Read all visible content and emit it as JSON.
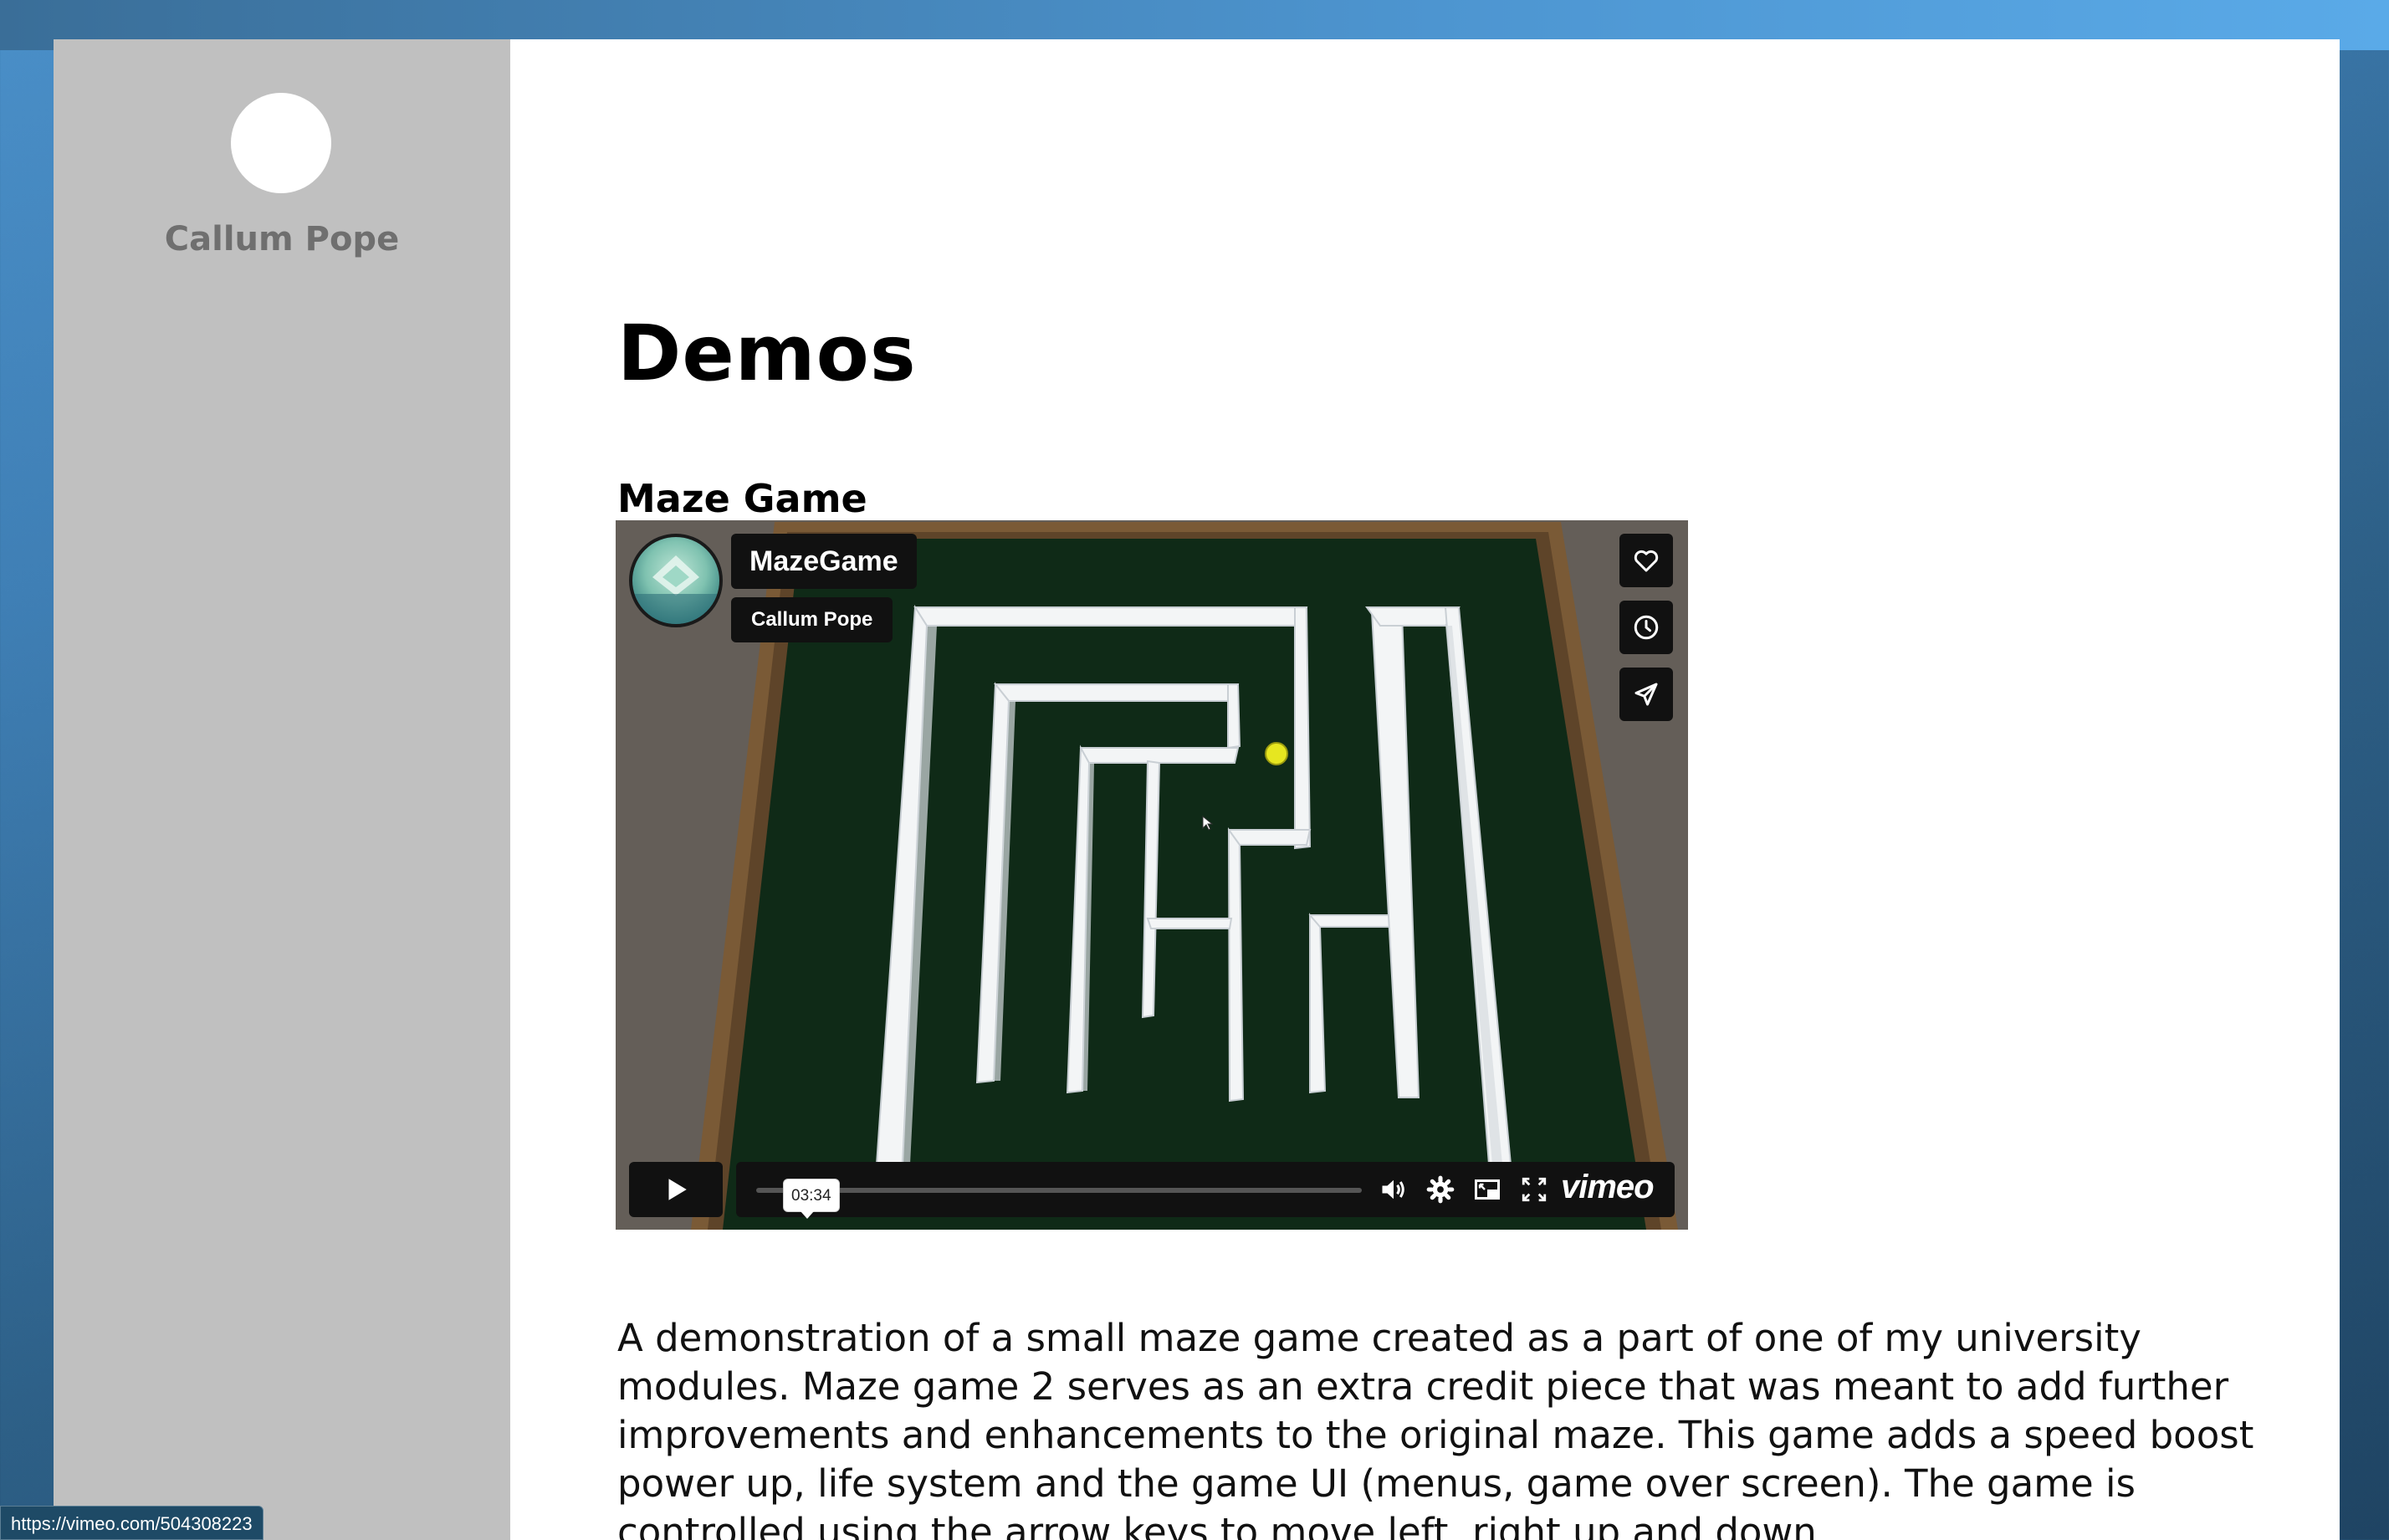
{
  "sidebar": {
    "author_name": "Callum Pope"
  },
  "main": {
    "page_title": "Demos",
    "section_title": "Maze Game",
    "description": "A demonstration of a small maze game created as a part of one of my university modules. Maze game 2 serves as an extra credit piece that was meant to add further improvements and enhancements to the original maze. This game adds a speed boost power up, life system and the game UI (menus, game over screen). The game is controlled using the arrow keys to move left, right up and down."
  },
  "video": {
    "title": "MazeGame",
    "author": "Callum Pope",
    "duration_tooltip": "03:34",
    "progress": 0.0,
    "brand": "vimeo",
    "side_buttons": [
      "heart-icon",
      "clock-icon",
      "send-icon"
    ],
    "controls": [
      "play-icon",
      "volume-icon",
      "settings-icon",
      "pip-icon",
      "fullscreen-icon"
    ]
  },
  "status_bar": {
    "url": "https://vimeo.com/504308223"
  },
  "colors": {
    "sidebar_bg": "#c0c0c0",
    "author_name": "#6f6f6f",
    "maze_floor": "#0f2a17",
    "maze_frame": "#7a5a36",
    "ball": "#e6e620"
  }
}
